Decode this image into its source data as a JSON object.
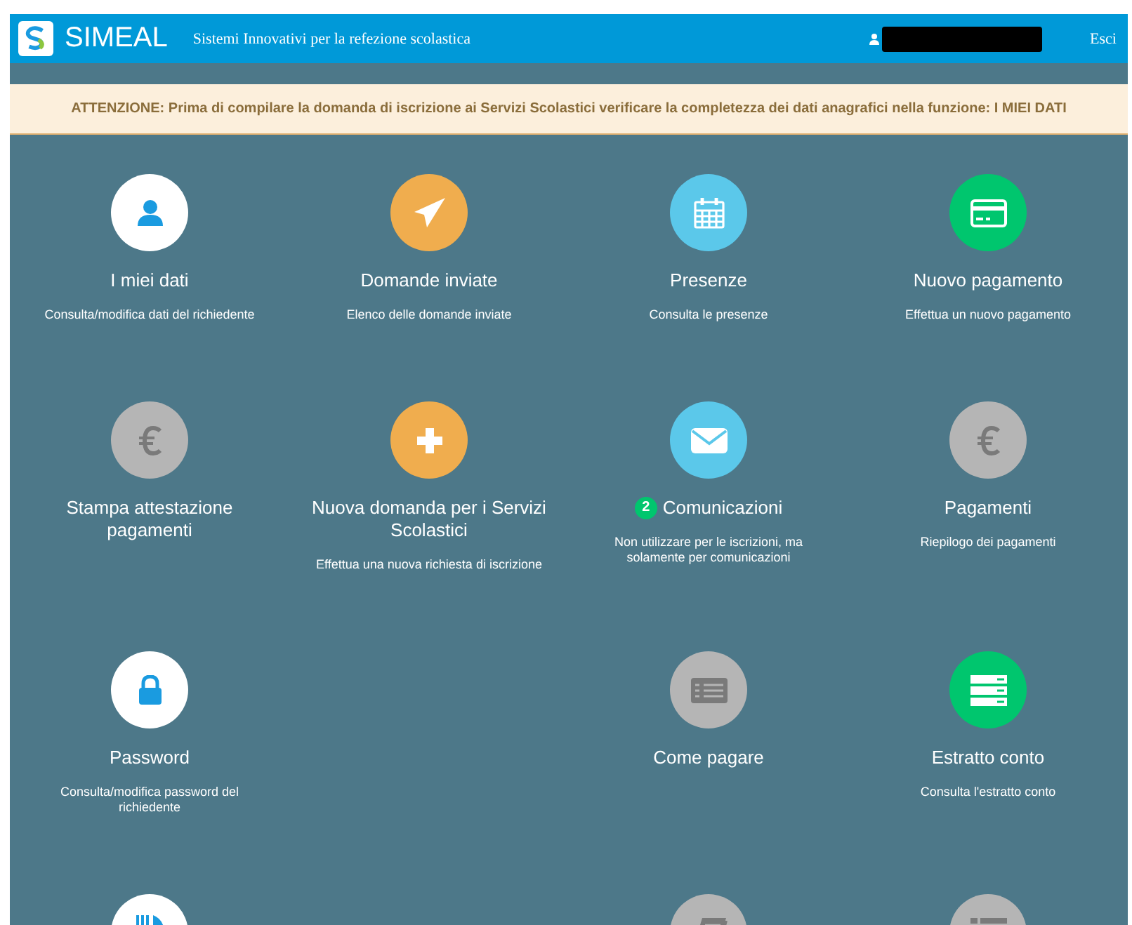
{
  "header": {
    "brand": "SIMEAL",
    "tagline": "Sistemi Innovativi per la refezione scolastica",
    "logout": "Esci"
  },
  "notice": "ATTENZIONE: Prima di compilare la domanda di iscrizione ai Servizi Scolastici verificare la completezza dei dati anagrafici nella funzione: I MIEI DATI",
  "tiles": [
    {
      "kind": "person",
      "color": "#ffffff",
      "title": "I miei dati",
      "description": "Consulta/modifica dati del richiedente"
    },
    {
      "kind": "plane",
      "color": "#f0ad4e",
      "title": "Domande inviate",
      "description": "Elenco delle domande inviate"
    },
    {
      "kind": "calendar",
      "color": "#5bc8ea",
      "title": "Presenze",
      "description": "Consulta le presenze"
    },
    {
      "kind": "card",
      "color": "#00c66e",
      "title": "Nuovo pagamento",
      "description": "Effettua un nuovo pagamento"
    },
    {
      "kind": "euro",
      "color": "#b5b5b5",
      "title": "Stampa attestazione pagamenti"
    },
    {
      "kind": "plus",
      "color": "#f0ad4e",
      "title": "Nuova domanda per i Servizi Scolastici",
      "description": "Effettua una nuova richiesta di iscrizione"
    },
    {
      "kind": "envelope",
      "color": "#5bc8ea",
      "title": "Comunicazioni",
      "badge": "2",
      "description": "Non utilizzare per le iscrizioni, ma solamente per comunicazioni"
    },
    {
      "kind": "euro",
      "color": "#b5b5b5",
      "title": "Pagamenti",
      "description": "Riepilogo dei pagamenti"
    },
    {
      "kind": "lock",
      "color": "#ffffff",
      "title": "Password",
      "description": "Consulta/modifica password del richiedente"
    },
    {
      "kind": "blank"
    },
    {
      "kind": "panel",
      "color": "#b5b5b5",
      "title": "Come pagare"
    },
    {
      "kind": "server",
      "color": "#00c66e",
      "title": "Estratto conto",
      "description": "Consulta l'estratto conto"
    },
    {
      "kind": "cutlery",
      "color": "#ffffff"
    },
    {
      "kind": "blank"
    },
    {
      "kind": "book",
      "color": "#b5b5b5"
    },
    {
      "kind": "list",
      "color": "#b5b5b5"
    }
  ]
}
